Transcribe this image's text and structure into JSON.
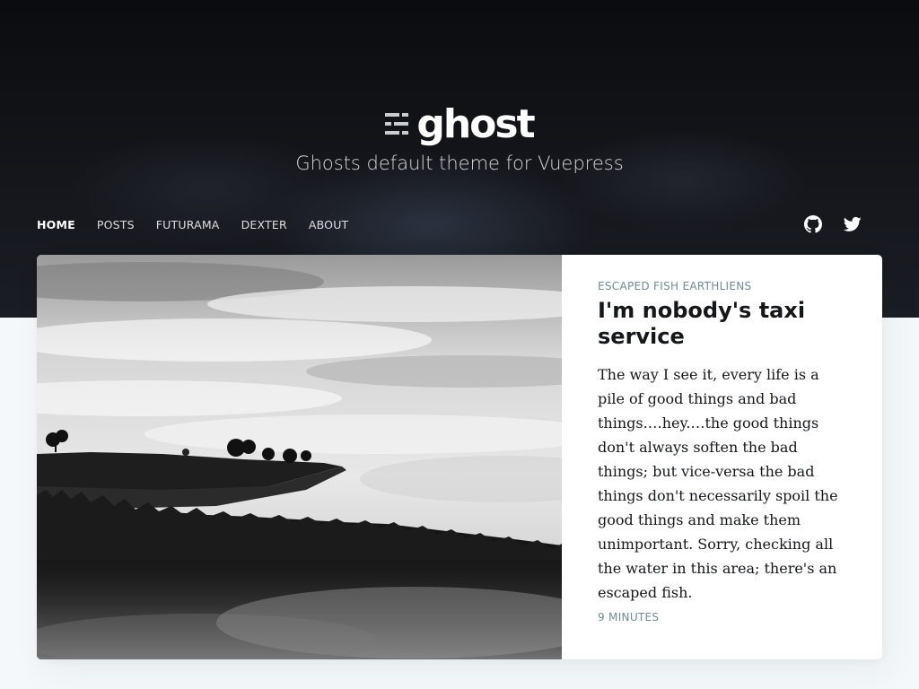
{
  "site": {
    "logo_text": "ghost",
    "logo_icon": "ghost-logo-icon",
    "tagline": "Ghosts default theme for Vuepress"
  },
  "nav": {
    "items": [
      {
        "label": "HOME",
        "active": true
      },
      {
        "label": "POSTS",
        "active": false
      },
      {
        "label": "FUTURAMA",
        "active": false
      },
      {
        "label": "DEXTER",
        "active": false
      },
      {
        "label": "ABOUT",
        "active": false
      }
    ]
  },
  "social": [
    {
      "icon": "github-icon"
    },
    {
      "icon": "twitter-icon"
    }
  ],
  "featured_post": {
    "tags": "ESCAPED FISH EARTHLIENS",
    "title": "I'm nobody's taxi service",
    "excerpt": "The way I see it, every life is a pile of good things and bad things.…hey.…the good things don't always soften the bad things; but vice-versa the bad things don't necessarily spoil the good things and make them unimportant. Sorry, checking all the water in this area; there's an escaped fish.",
    "reading_time": "9 MINUTES",
    "image_description": "foggy-hills-photo"
  },
  "colors": {
    "hero_bg": "#0b0c0f",
    "page_bg": "#f4f8fb",
    "meta": "#738a94",
    "text": "#15171a"
  }
}
